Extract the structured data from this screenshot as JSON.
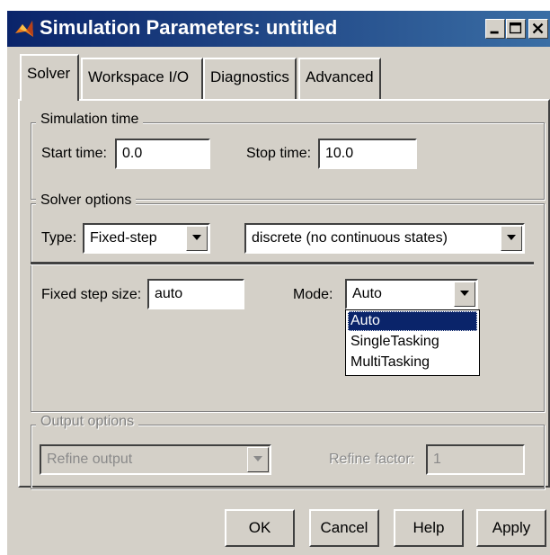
{
  "window": {
    "title": "Simulation Parameters: untitled"
  },
  "tabs": [
    {
      "label": "Solver",
      "active": true
    },
    {
      "label": "Workspace I/O",
      "active": false
    },
    {
      "label": "Diagnostics",
      "active": false
    },
    {
      "label": "Advanced",
      "active": false
    }
  ],
  "simulation_time": {
    "legend": "Simulation time",
    "start_label": "Start time:",
    "start_value": "0.0",
    "stop_label": "Stop time:",
    "stop_value": "10.0"
  },
  "solver_options": {
    "legend": "Solver options",
    "type_label": "Type:",
    "type_value": "Fixed-step",
    "solver_value": "discrete (no continuous states)",
    "fixed_step_label": "Fixed step size:",
    "fixed_step_value": "auto",
    "mode_label": "Mode:",
    "mode_value": "Auto",
    "mode_options": [
      "Auto",
      "SingleTasking",
      "MultiTasking"
    ]
  },
  "output_options": {
    "legend": "Output options",
    "refine_select_value": "Refine output",
    "refine_factor_label": "Refine factor:",
    "refine_factor_value": "1"
  },
  "buttons": {
    "ok": "OK",
    "cancel": "Cancel",
    "help": "Help",
    "apply": "Apply"
  },
  "colors": {
    "face": "#d4d0c8",
    "title_start": "#0a246a",
    "title_end": "#3a6ea5",
    "selection": "#0a246a"
  },
  "icons": [
    "matlab-logo-icon",
    "minimize-icon",
    "maximize-icon",
    "close-icon",
    "dropdown-arrow-icon"
  ]
}
